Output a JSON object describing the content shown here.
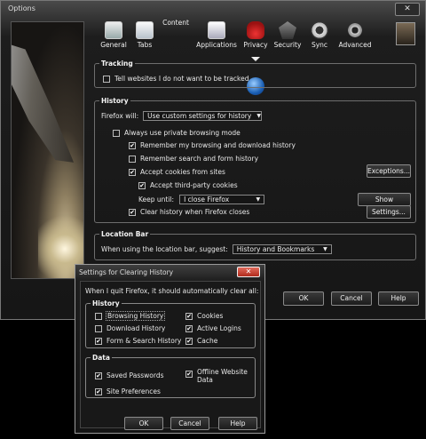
{
  "window": {
    "title": "Options",
    "close": "✕"
  },
  "toolbar": [
    {
      "label": "General",
      "icon": "general-icon"
    },
    {
      "label": "Tabs",
      "icon": "tabs-icon"
    },
    {
      "label": "Content",
      "icon": "content-icon"
    },
    {
      "label": "Applications",
      "icon": "applications-icon"
    },
    {
      "label": "Privacy",
      "icon": "privacy-icon",
      "selected": true
    },
    {
      "label": "Security",
      "icon": "security-icon"
    },
    {
      "label": "Sync",
      "icon": "sync-icon"
    },
    {
      "label": "Advanced",
      "icon": "advanced-icon"
    }
  ],
  "tracking": {
    "legend": "Tracking",
    "dnt_label": "Tell websites I do not want to be tracked"
  },
  "history": {
    "legend": "History",
    "firefox_will_label": "Firefox will:",
    "firefox_will_value": "Use custom settings for history",
    "private_label": "Always use private browsing mode",
    "remember_browsing_label": "Remember my browsing and download history",
    "remember_search_label": "Remember search and form history",
    "accept_cookies_label": "Accept cookies from sites",
    "exceptions_button": "Exceptions...",
    "third_party_label": "Accept third-party cookies",
    "keep_until_label": "Keep until:",
    "keep_until_value": "I close Firefox",
    "show_cookies_button": "Show Cookies...",
    "clear_history_label": "Clear history when Firefox closes",
    "settings_button": "Settings..."
  },
  "location_bar": {
    "legend": "Location Bar",
    "suggest_label": "When using the location bar, suggest:",
    "suggest_value": "History and Bookmarks"
  },
  "buttons": {
    "ok": "OK",
    "cancel": "Cancel",
    "help": "Help"
  },
  "clear_dialog": {
    "title": "Settings for Clearing History",
    "close": "✕",
    "intro": "When I quit Firefox, it should automatically clear all:",
    "history_legend": "History",
    "browsing_history": "Browsing History",
    "download_history": "Download History",
    "form_search_history": "Form & Search History",
    "cookies": "Cookies",
    "active_logins": "Active Logins",
    "cache": "Cache",
    "data_legend": "Data",
    "saved_passwords": "Saved Passwords",
    "offline_data": "Offline Website Data",
    "site_preferences": "Site Preferences",
    "ok": "OK",
    "cancel": "Cancel",
    "help": "Help"
  }
}
